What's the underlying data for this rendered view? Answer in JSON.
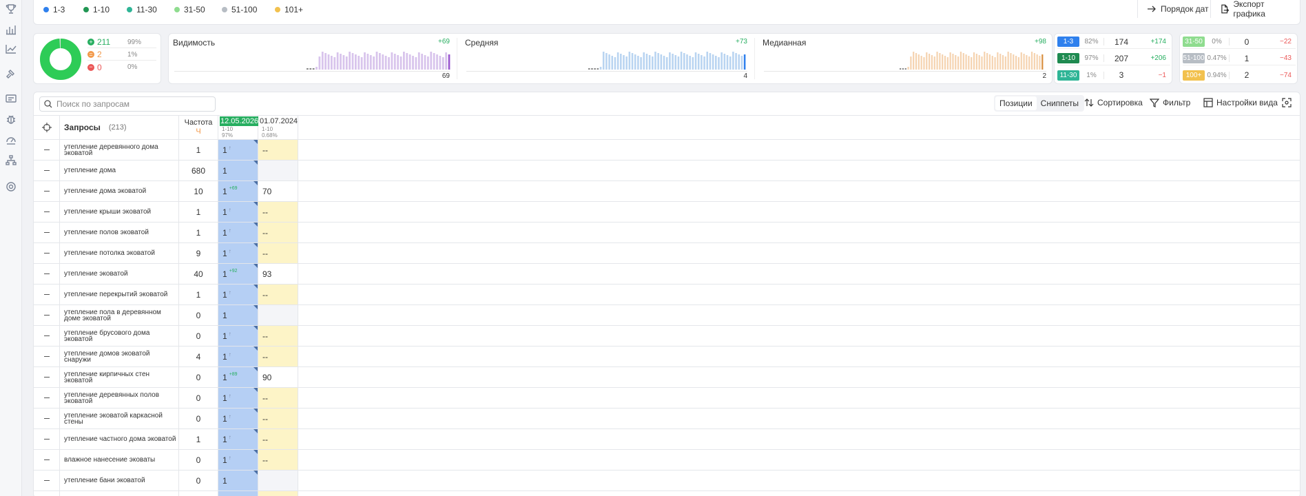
{
  "colors": {
    "accent": "#2f80ed",
    "green": "#27ae60",
    "red": "#eb5757",
    "orange": "#f2994a"
  },
  "sidebar": {
    "icons": [
      "trophy-icon",
      "bar-chart-icon",
      "line-chart-icon",
      "hammer-icon",
      "ad-icon",
      "bug-icon",
      "gauge-icon",
      "sitemap-icon",
      "gear-icon"
    ]
  },
  "legend": {
    "items": [
      {
        "label": "1-3",
        "color": "#2f80ed"
      },
      {
        "label": "1-10",
        "color": "#219653"
      },
      {
        "label": "11-30",
        "color": "#2fb596"
      },
      {
        "label": "31-50",
        "color": "#8fdc8f"
      },
      {
        "label": "51-100",
        "color": "#b7bdc4"
      },
      {
        "label": "101+",
        "color": "#f2c14e"
      }
    ],
    "date_order": "Порядок дат",
    "export_chart": "Экспорт графика"
  },
  "summary": {
    "rows": [
      {
        "count": "211",
        "pct": "99%",
        "color": "#27ae60",
        "sign": "+"
      },
      {
        "count": "2",
        "pct": "1%",
        "color": "#f2994a",
        "sign": "="
      },
      {
        "count": "0",
        "pct": "0%",
        "color": "#eb5757",
        "sign": "−"
      }
    ],
    "donut_share": 0.99
  },
  "metrics": [
    {
      "title": "Видимость",
      "delta": "+69",
      "value": "69",
      "bar_color": "#d8c4ec",
      "last_color": "#9b59d0"
    },
    {
      "title": "Средняя",
      "delta": "+73",
      "value": "4",
      "bar_color": "#b9d4f1",
      "last_color": "#2f80ed"
    },
    {
      "title": "Медианная",
      "delta": "+98",
      "value": "2",
      "bar_color": "#f5d3b0",
      "last_color": "#d99040"
    }
  ],
  "ranks_left": [
    {
      "label": "1-3",
      "pct": "82%",
      "count": "174",
      "delta": "+174",
      "color": "#2f80ed",
      "dcolor": "#27ae60"
    },
    {
      "label": "1-10",
      "pct": "97%",
      "count": "207",
      "delta": "+206",
      "color": "#1e8a50",
      "dcolor": "#27ae60"
    },
    {
      "label": "11-30",
      "pct": "1%",
      "count": "3",
      "delta": "−1",
      "color": "#2fb596",
      "dcolor": "#eb5757"
    }
  ],
  "ranks_right": [
    {
      "label": "31-50",
      "pct": "0%",
      "count": "0",
      "delta": "−22",
      "color": "#8fdc8f",
      "dcolor": "#eb5757"
    },
    {
      "label": "51-100",
      "pct": "0.47%",
      "count": "1",
      "delta": "−43",
      "color": "#b7bdc4",
      "dcolor": "#eb5757"
    },
    {
      "label": "100+",
      "pct": "0.94%",
      "count": "2",
      "delta": "−74",
      "color": "#f2c14e",
      "dcolor": "#eb5757"
    }
  ],
  "toolbar": {
    "search_placeholder": "Поиск по запросам",
    "positions": "Позиции",
    "snippets": "Сниппеты",
    "sort": "Сортировка",
    "filter": "Фильтр",
    "view_settings": "Настройки вида"
  },
  "table": {
    "queries_label": "Запросы",
    "queries_count": "(213)",
    "freq_label": "Частота",
    "freq_sub": "Ч",
    "date1": {
      "label": "12.05.2026",
      "range": "1-10",
      "pct": "97%"
    },
    "date2": {
      "label": "01.07.2024",
      "range": "1-10",
      "pct": "0.68%"
    },
    "rows": [
      {
        "q": "утепление деревянного дома эковатой",
        "f": "1",
        "d1": "1",
        "s1": "↑",
        "d2": "--",
        "bg": "y"
      },
      {
        "q": "утепление дома",
        "f": "680",
        "d1": "1",
        "s1": "",
        "d2": "",
        "bg": "g"
      },
      {
        "q": "утепление дома эковатой",
        "f": "10",
        "d1": "1",
        "s1": "+69",
        "d2": "70",
        "bg": "w"
      },
      {
        "q": "утепление крыши эковатой",
        "f": "1",
        "d1": "1",
        "s1": "↑",
        "d2": "--",
        "bg": "y"
      },
      {
        "q": "утепление полов эковатой",
        "f": "1",
        "d1": "1",
        "s1": "↑",
        "d2": "--",
        "bg": "y"
      },
      {
        "q": "утепление потолка эковатой",
        "f": "9",
        "d1": "1",
        "s1": "↑",
        "d2": "--",
        "bg": "y"
      },
      {
        "q": "утепление эковатой",
        "f": "40",
        "d1": "1",
        "s1": "+92",
        "d2": "93",
        "bg": "w"
      },
      {
        "q": "утепление перекрытий эковатой",
        "f": "1",
        "d1": "1",
        "s1": "↑",
        "d2": "--",
        "bg": "y"
      },
      {
        "q": "утепление пола в деревянном доме эковатой",
        "f": "0",
        "d1": "1",
        "s1": "",
        "d2": "",
        "bg": "g"
      },
      {
        "q": "утепление брусового дома эковатой",
        "f": "0",
        "d1": "1",
        "s1": "↑",
        "d2": "--",
        "bg": "y"
      },
      {
        "q": "утепление домов эковатой снаружи",
        "f": "4",
        "d1": "1",
        "s1": "↑",
        "d2": "--",
        "bg": "y"
      },
      {
        "q": "утепление кирпичных стен эковатой",
        "f": "0",
        "d1": "1",
        "s1": "+89",
        "d2": "90",
        "bg": "w"
      },
      {
        "q": "утепление деревянных полов эковатой",
        "f": "0",
        "d1": "1",
        "s1": "↑",
        "d2": "--",
        "bg": "y"
      },
      {
        "q": "утепление эковатой каркасной стены",
        "f": "0",
        "d1": "1",
        "s1": "↑",
        "d2": "--",
        "bg": "y"
      },
      {
        "q": "утепление частного дома эковатой",
        "f": "1",
        "d1": "1",
        "s1": "↑",
        "d2": "--",
        "bg": "y"
      },
      {
        "q": "влажное нанесение эковаты",
        "f": "0",
        "d1": "1",
        "s1": "↑",
        "d2": "--",
        "bg": "y"
      },
      {
        "q": "утепление бани эковатой",
        "f": "0",
        "d1": "1",
        "s1": "",
        "d2": "",
        "bg": "g"
      },
      {
        "q": "",
        "f": "",
        "d1": "",
        "s1": "",
        "d2": "",
        "bg": "y"
      }
    ]
  }
}
